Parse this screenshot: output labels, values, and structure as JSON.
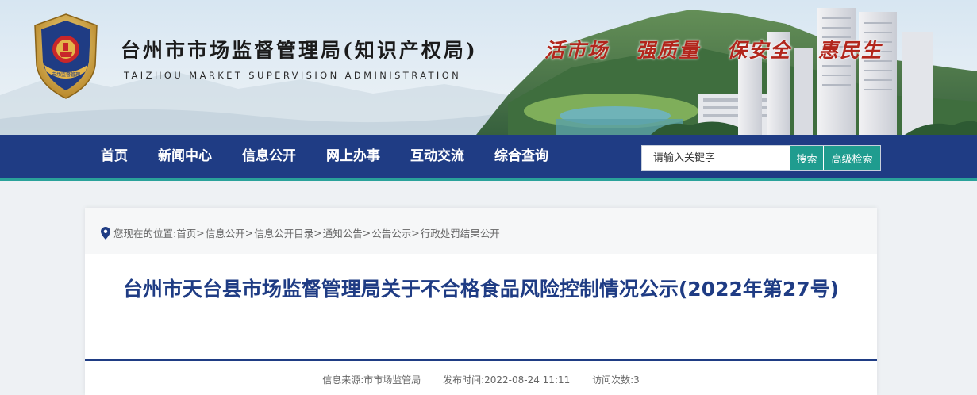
{
  "header": {
    "site_title": "台州市市场监督管理局(知识产权局)",
    "site_subtitle": "TAIZHOU MARKET SUPERVISION ADMINISTRATION",
    "emblem_text": "市场监督管理",
    "slogans": [
      "活市场",
      "强质量",
      "保安全",
      "惠民生"
    ]
  },
  "nav": {
    "items": [
      "首页",
      "新闻中心",
      "信息公开",
      "网上办事",
      "互动交流",
      "综合查询"
    ]
  },
  "search": {
    "placeholder": "请输入关键字",
    "search_label": "搜索",
    "advanced_label": "高级检索"
  },
  "breadcrumb": {
    "prefix": "您现在的位置:",
    "items": [
      "首页",
      "信息公开",
      "信息公开目录",
      "通知公告",
      "公告公示",
      "行政处罚结果公开"
    ],
    "separator": ">"
  },
  "article": {
    "title": "台州市天台县市场监督管理局关于不合格食品风险控制情况公示(2022年第27号)",
    "source": "信息来源:市市场监管局",
    "publish_time": "发布时间:2022-08-24 11:11",
    "visits": "访问次数:3"
  },
  "colors": {
    "nav_bg": "#1f3c84",
    "accent_teal": "#2aa29a",
    "title_blue": "#1f3c84",
    "slogan_red": "#b2261c"
  }
}
